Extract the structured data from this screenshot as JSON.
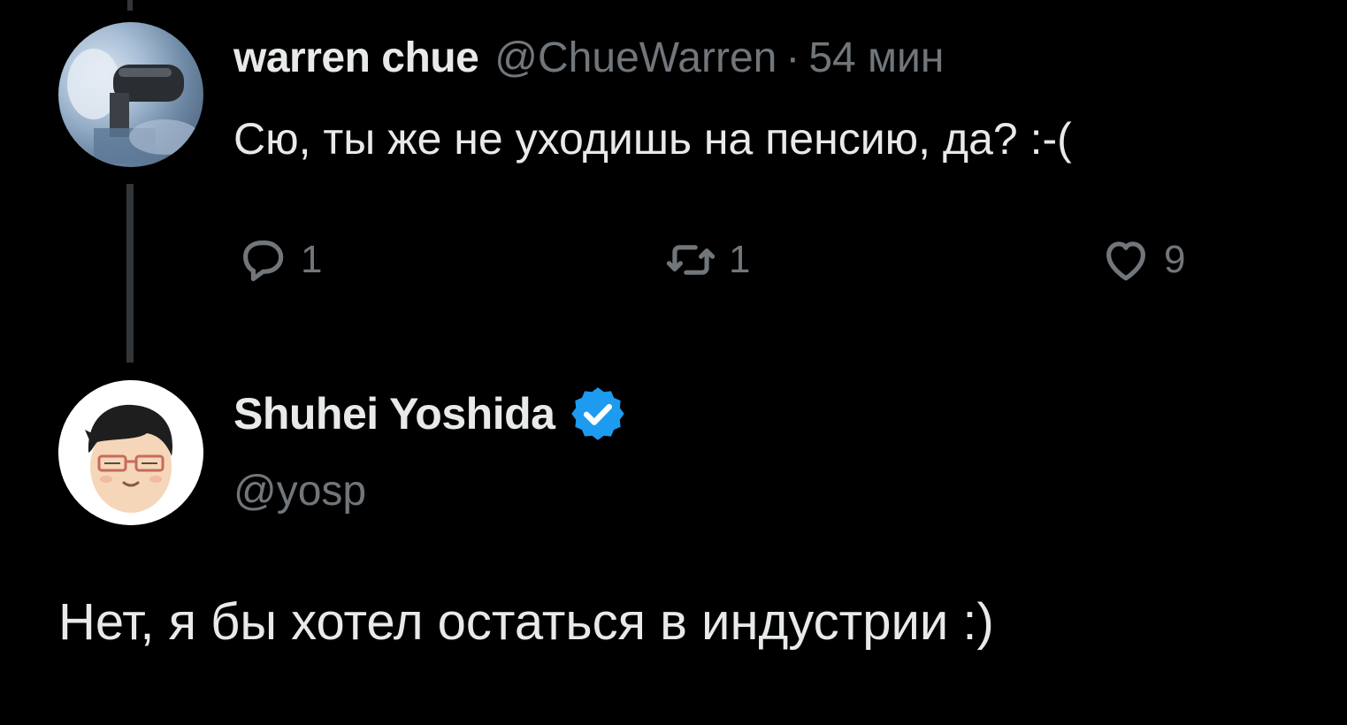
{
  "reply": {
    "display_name": "warren chue",
    "handle": "@ChueWarren",
    "separator": "·",
    "time": "54 мин",
    "text": "Сю, ты же не уходишь на пенсию, да? :-(",
    "actions": {
      "reply_count": "1",
      "retweet_count": "1",
      "like_count": "9"
    }
  },
  "author": {
    "display_name": "Shuhei Yoshida",
    "handle": "@yosp",
    "verified": true,
    "text": "Нет, я бы хотел остаться в индустрии :)"
  },
  "colors": {
    "background": "#000000",
    "primary_text": "#e7e9ea",
    "secondary_text": "#71767b",
    "verified_badge": "#1d9bf0",
    "thread_line": "#333639"
  }
}
